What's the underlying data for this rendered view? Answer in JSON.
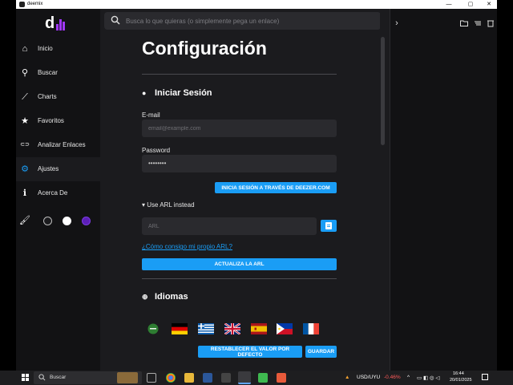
{
  "window": {
    "title": "deemix",
    "controls": [
      "—",
      "▢",
      "✕"
    ]
  },
  "app": {
    "logo": "d"
  },
  "search": {
    "placeholder": "Busca lo que quieras (o simplemente pega un enlace)"
  },
  "sidebar": {
    "items": [
      {
        "label": "Inicio",
        "icon": "home-icon",
        "glyph": "⌂"
      },
      {
        "label": "Buscar",
        "icon": "search-icon",
        "glyph": "⚲"
      },
      {
        "label": "Charts",
        "icon": "trending-up-icon",
        "glyph": "⟋"
      },
      {
        "label": "Favoritos",
        "icon": "star-icon",
        "glyph": "★"
      },
      {
        "label": "Analizar Enlaces",
        "icon": "link-icon",
        "glyph": "⊂⊃"
      },
      {
        "label": "Ajustes",
        "icon": "gear-icon",
        "glyph": "⚙"
      },
      {
        "label": "Acerca De",
        "icon": "info-icon",
        "glyph": "ℹ"
      }
    ],
    "active_index": 5,
    "theme": {
      "brush_icon": "brush-icon",
      "brush_glyph": "🖌",
      "dots": [
        "#1b1b1e",
        "#ffffff",
        "#5c1fb8"
      ]
    }
  },
  "right_panel": {
    "expand_glyph": "›",
    "icons": [
      "folder-icon",
      "list-icon",
      "trash-icon"
    ]
  },
  "settings": {
    "title": "Configuración",
    "login": {
      "heading": "Iniciar Sesión",
      "email_label": "E-mail",
      "email_placeholder": "email@example.com",
      "password_label": "Password",
      "password_value": "••••••••",
      "login_button": "INICIA SESIÓN A TRAVÉS DE DEEZER.COM",
      "arl_toggle": "▾ Use ARL instead",
      "arl_placeholder": "ARL",
      "arl_help_link": "¿Cómo consigo mi propio ARL?",
      "update_arl_button": "ACTUALIZA LA ARL"
    },
    "languages": {
      "heading": "Idiomas",
      "flags": [
        "arabic",
        "germany",
        "greece",
        "united-kingdom",
        "spain",
        "philippines",
        "france"
      ]
    },
    "reset_button": "RESTABLECER EL VALOR POR DEFECTO",
    "save_button": "GUARDAR"
  },
  "taskbar": {
    "search_label": "Buscar",
    "currency": "USD/UYU",
    "currency_change": "-0.46%",
    "time": "16:44",
    "date": "20/01/2025"
  }
}
